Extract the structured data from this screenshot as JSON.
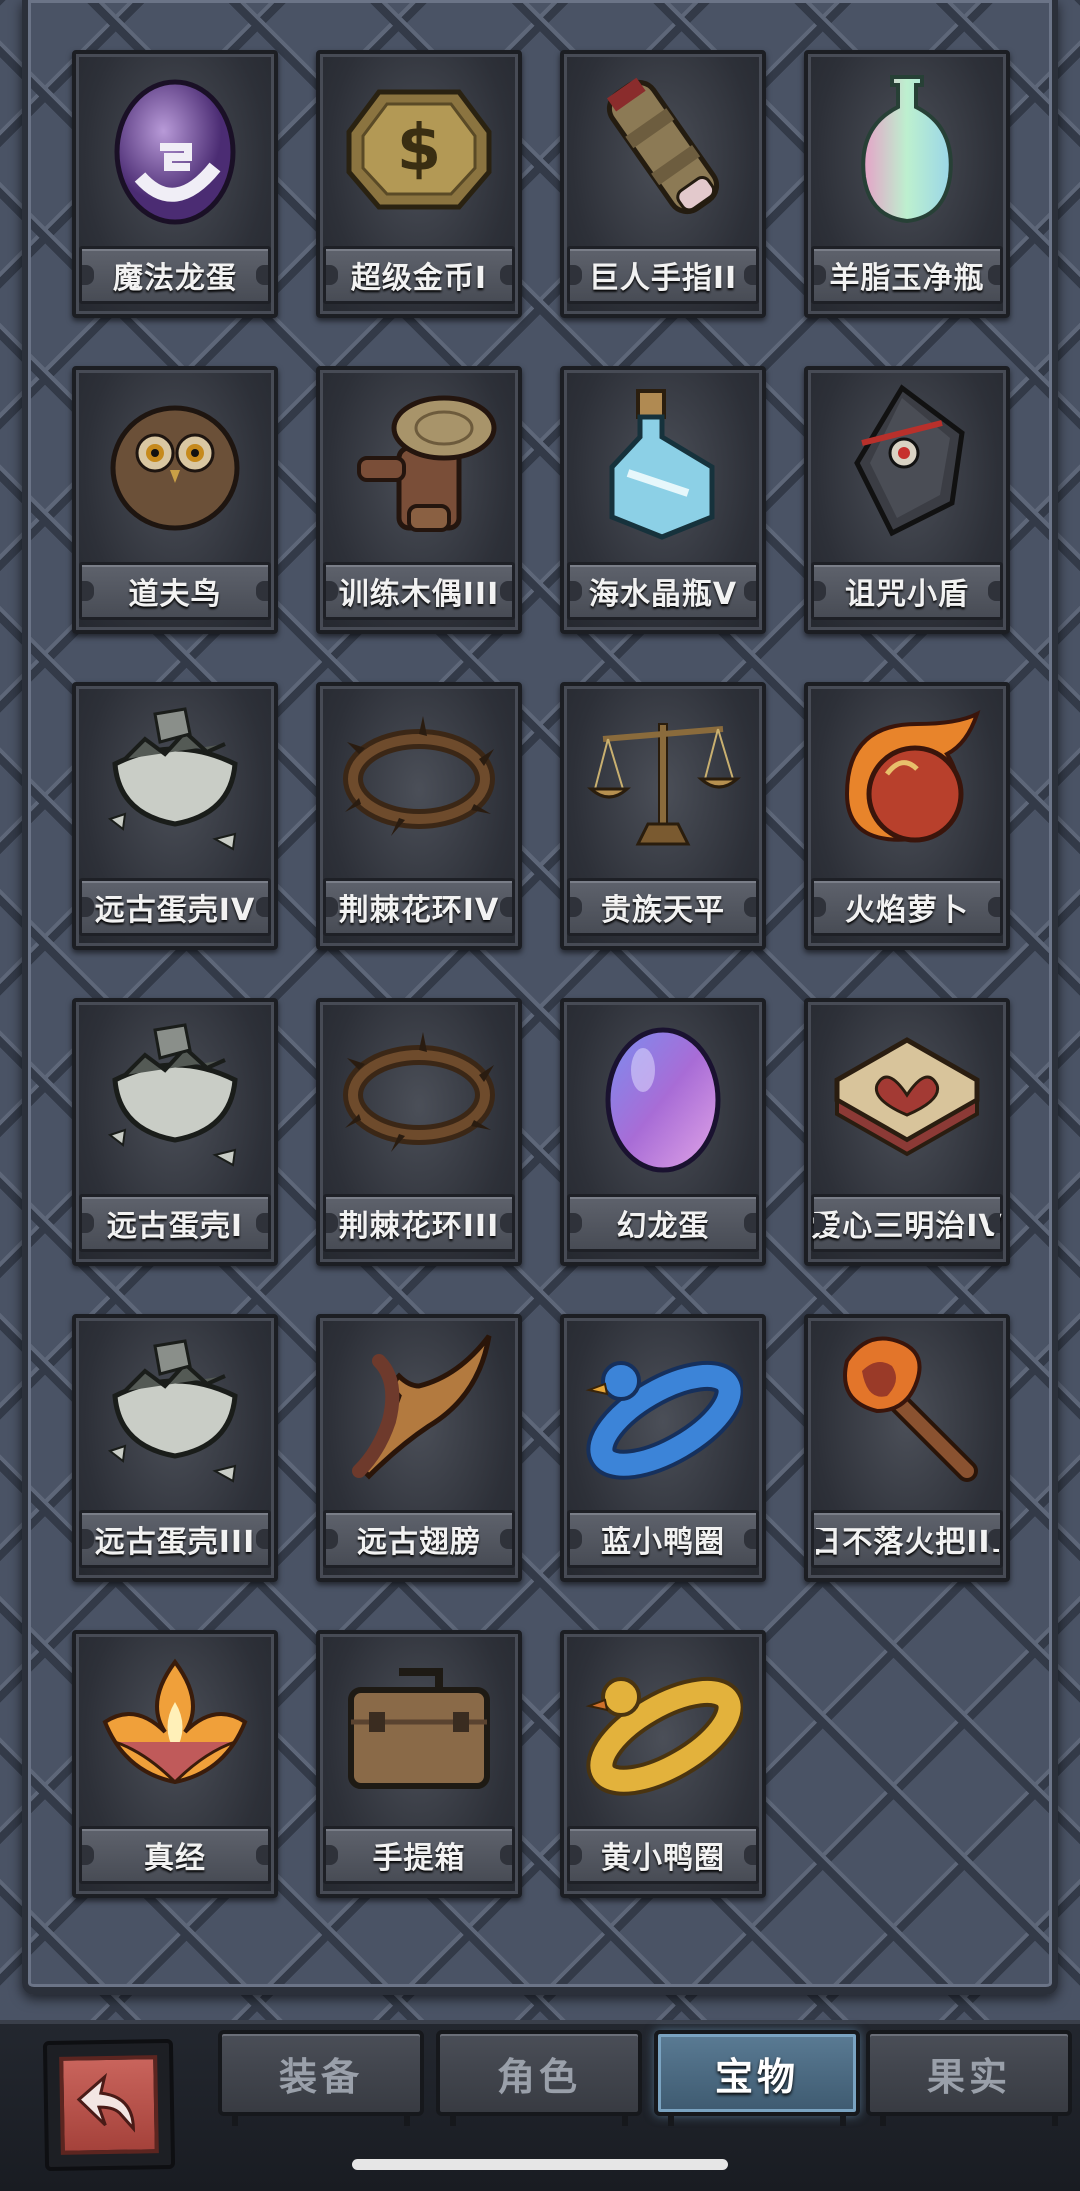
{
  "items": [
    {
      "name": "魔法龙蛋",
      "icon": "purple-dragon-egg-icon"
    },
    {
      "name": "超级金币I",
      "icon": "gold-coin-icon"
    },
    {
      "name": "巨人手指II",
      "icon": "giant-finger-icon"
    },
    {
      "name": "羊脂玉净瓶",
      "icon": "jade-vase-icon"
    },
    {
      "name": "道夫鸟",
      "icon": "owl-bird-icon"
    },
    {
      "name": "训练木偶III",
      "icon": "wooden-dummy-icon"
    },
    {
      "name": "海水晶瓶V",
      "icon": "seawater-bottle-icon"
    },
    {
      "name": "诅咒小盾",
      "icon": "cursed-shield-icon"
    },
    {
      "name": "远古蛋壳IV",
      "icon": "ancient-eggshell-icon"
    },
    {
      "name": "荆棘花环IV",
      "icon": "thorn-wreath-icon"
    },
    {
      "name": "贵族天平",
      "icon": "scales-icon"
    },
    {
      "name": "火焰萝卜",
      "icon": "fire-radish-icon"
    },
    {
      "name": "远古蛋壳I",
      "icon": "ancient-eggshell-icon"
    },
    {
      "name": "荆棘花环III",
      "icon": "thorn-wreath-icon"
    },
    {
      "name": "幻龙蛋",
      "icon": "illusion-dragon-egg-icon"
    },
    {
      "name": "爱心三明治IV",
      "icon": "heart-sandwich-icon"
    },
    {
      "name": "远古蛋壳III",
      "icon": "ancient-eggshell-icon"
    },
    {
      "name": "远古翅膀",
      "icon": "ancient-wing-icon"
    },
    {
      "name": "蓝小鸭圈",
      "icon": "blue-duck-ring-icon"
    },
    {
      "name": "日不落火把III",
      "icon": "torch-icon"
    },
    {
      "name": "真经",
      "icon": "flame-lotus-icon"
    },
    {
      "name": "手提箱",
      "icon": "suitcase-icon"
    },
    {
      "name": "黄小鸭圈",
      "icon": "yellow-duck-ring-icon"
    }
  ],
  "tabs": [
    {
      "label": "装备",
      "active": false
    },
    {
      "label": "角色",
      "active": false
    },
    {
      "label": "宝物",
      "active": true
    },
    {
      "label": "果实",
      "active": false
    }
  ],
  "back_button_icon": "back-arrow-icon",
  "colors": {
    "active_tab": "#4a6a83",
    "label_bg": "#555962",
    "back_button": "#b44f47"
  }
}
